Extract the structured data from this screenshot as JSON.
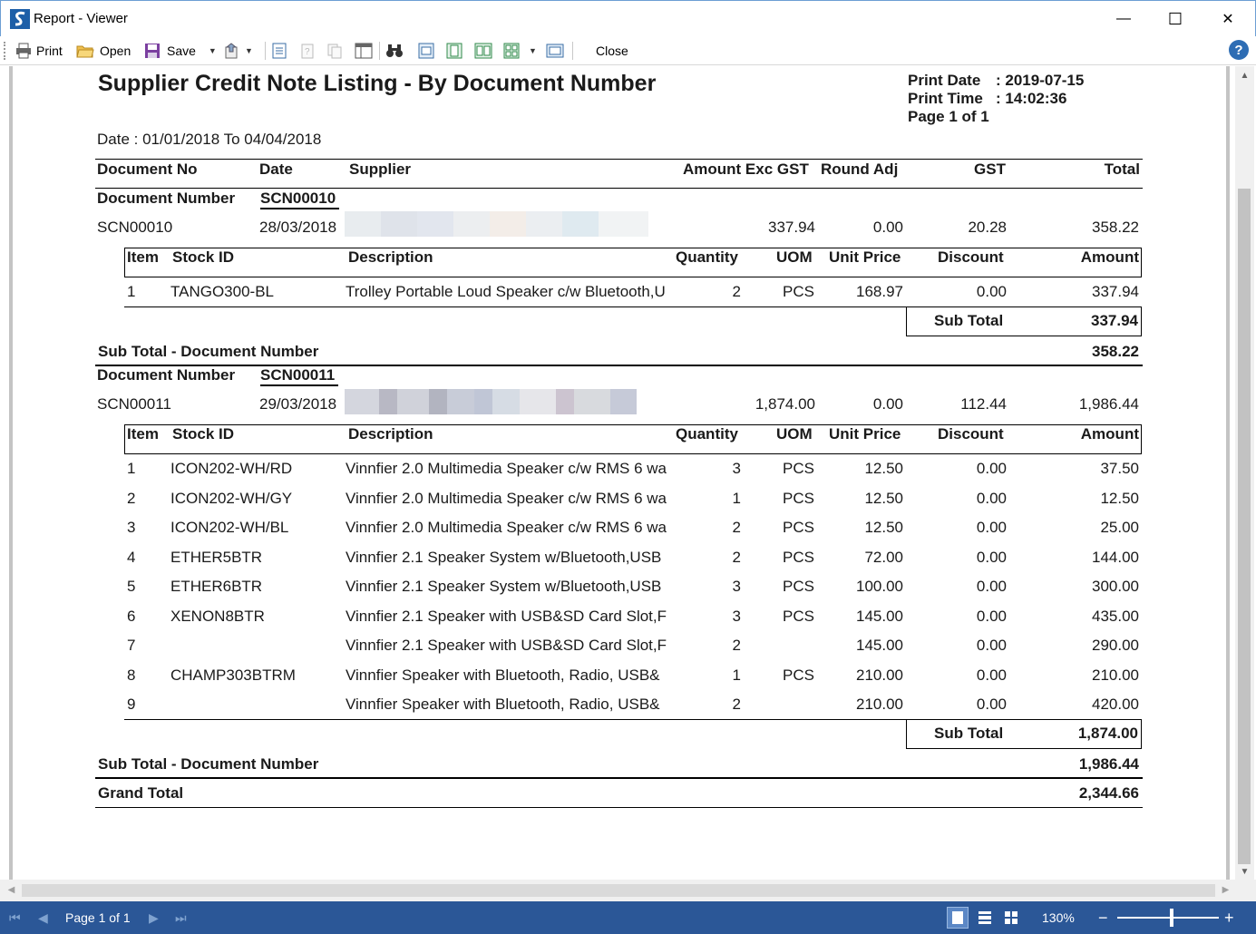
{
  "window": {
    "title": "Report - Viewer",
    "minimize": "—",
    "maximize": "☐",
    "close": "✕"
  },
  "toolbar": {
    "print": "Print",
    "open": "Open",
    "save": "Save",
    "close": "Close",
    "help": "?"
  },
  "report": {
    "title": "Supplier Credit Note Listing - By Document Number",
    "print_date_label": "Print Date",
    "print_date": ": 2019-07-15",
    "print_time_label": "Print Time",
    "print_time": ": 14:02:36",
    "page_label": "Page 1 of 1",
    "date_range": "Date : 01/01/2018 To 04/04/2018",
    "headers": {
      "doc_no": "Document No",
      "date": "Date",
      "supplier": "Supplier",
      "amount_exc_gst": "Amount Exc GST",
      "round_adj": "Round Adj",
      "gst": "GST",
      "total": "Total"
    },
    "item_headers": {
      "item": "Item",
      "stock_id": "Stock ID",
      "description": "Description",
      "quantity": "Quantity",
      "uom": "UOM",
      "unit_price": "Unit Price",
      "discount": "Discount",
      "amount": "Amount"
    },
    "group_label": "Document Number",
    "sub_total_label": "Sub Total",
    "sub_total_doc_label": "Sub Total - Document Number",
    "grand_total_label": "Grand Total",
    "grand_total": "2,344.66",
    "documents": [
      {
        "doc_number": "SCN00010",
        "doc_no": "SCN00010",
        "date": "28/03/2018",
        "amount_exc_gst": "337.94",
        "round_adj": "0.00",
        "gst": "20.28",
        "total": "358.22",
        "sub_total": "337.94",
        "sub_total_doc": "358.22",
        "items": [
          {
            "item": "1",
            "stock_id": "TANGO300-BL",
            "description": "Trolley Portable Loud Speaker c/w Bluetooth,U",
            "quantity": "2",
            "uom": "PCS",
            "unit_price": "168.97",
            "discount": "0.00",
            "amount": "337.94"
          }
        ]
      },
      {
        "doc_number": "SCN00011",
        "doc_no": "SCN00011",
        "date": "29/03/2018",
        "amount_exc_gst": "1,874.00",
        "round_adj": "0.00",
        "gst": "112.44",
        "total": "1,986.44",
        "sub_total": "1,874.00",
        "sub_total_doc": "1,986.44",
        "items": [
          {
            "item": "1",
            "stock_id": "ICON202-WH/RD",
            "description": "Vinnfier 2.0 Multimedia Speaker c/w RMS 6 wa",
            "quantity": "3",
            "uom": "PCS",
            "unit_price": "12.50",
            "discount": "0.00",
            "amount": "37.50"
          },
          {
            "item": "2",
            "stock_id": "ICON202-WH/GY",
            "description": "Vinnfier 2.0 Multimedia Speaker c/w RMS 6 wa",
            "quantity": "1",
            "uom": "PCS",
            "unit_price": "12.50",
            "discount": "0.00",
            "amount": "12.50"
          },
          {
            "item": "3",
            "stock_id": "ICON202-WH/BL",
            "description": "Vinnfier 2.0 Multimedia Speaker c/w RMS 6 wa",
            "quantity": "2",
            "uom": "PCS",
            "unit_price": "12.50",
            "discount": "0.00",
            "amount": "25.00"
          },
          {
            "item": "4",
            "stock_id": "ETHER5BTR",
            "description": "Vinnfier 2.1 Speaker System w/Bluetooth,USB",
            "quantity": "2",
            "uom": "PCS",
            "unit_price": "72.00",
            "discount": "0.00",
            "amount": "144.00"
          },
          {
            "item": "5",
            "stock_id": "ETHER6BTR",
            "description": "Vinnfier 2.1 Speaker System w/Bluetooth,USB",
            "quantity": "3",
            "uom": "PCS",
            "unit_price": "100.00",
            "discount": "0.00",
            "amount": "300.00"
          },
          {
            "item": "6",
            "stock_id": "XENON8BTR",
            "description": "Vinnfier 2.1 Speaker with USB&SD Card Slot,F",
            "quantity": "3",
            "uom": "PCS",
            "unit_price": "145.00",
            "discount": "0.00",
            "amount": "435.00"
          },
          {
            "item": "7",
            "stock_id": "",
            "description": "Vinnfier 2.1 Speaker with USB&SD Card Slot,F",
            "quantity": "2",
            "uom": "",
            "unit_price": "145.00",
            "discount": "0.00",
            "amount": "290.00"
          },
          {
            "item": "8",
            "stock_id": "CHAMP303BTRM",
            "description": "Vinnfier Speaker with Bluetooth, Radio, USB&",
            "quantity": "1",
            "uom": "PCS",
            "unit_price": "210.00",
            "discount": "0.00",
            "amount": "210.00"
          },
          {
            "item": "9",
            "stock_id": "",
            "description": "Vinnfier Speaker with Bluetooth, Radio, USB&",
            "quantity": "2",
            "uom": "",
            "unit_price": "210.00",
            "discount": "0.00",
            "amount": "420.00"
          }
        ]
      }
    ]
  },
  "statusbar": {
    "page_info": "Page 1 of 1",
    "zoom": "130%",
    "zoom_out": "−",
    "zoom_in": "+"
  },
  "colors": {
    "statusbar": "#2b5797",
    "titlebar_border": "#6d9fd4",
    "help": "#2e6db4"
  }
}
